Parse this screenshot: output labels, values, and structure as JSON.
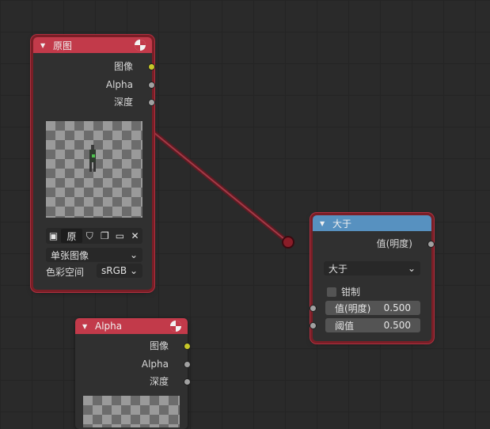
{
  "nodes": {
    "image_node": {
      "title": "原图",
      "outputs": [
        "图像",
        "Alpha",
        "深度"
      ],
      "image_name": "原",
      "source_option": "单张图像",
      "color_space_label": "色彩空间",
      "color_space_value": "sRGB",
      "header_color": "#c23a4a"
    },
    "greater_node": {
      "title": "大于",
      "output": "值(明度)",
      "operation": "大于",
      "clamp_label": "钳制",
      "inputs": [
        {
          "label": "值(明度)",
          "value": "0.500"
        },
        {
          "label": "阈值",
          "value": "0.500"
        }
      ],
      "header_color": "#5791c0"
    },
    "alpha_node": {
      "title": "Alpha",
      "outputs": [
        "图像",
        "Alpha",
        "深度"
      ],
      "header_color": "#c23a4a"
    }
  },
  "icons": {
    "image_type": "image-node-icon",
    "collapse": "chevron-down-icon",
    "browse": "image-browse-icon",
    "fake_user": "shield-icon",
    "duplicate": "copy-icon",
    "open": "folder-icon",
    "unlink": "close-icon"
  },
  "link_color": "#8a2a36"
}
